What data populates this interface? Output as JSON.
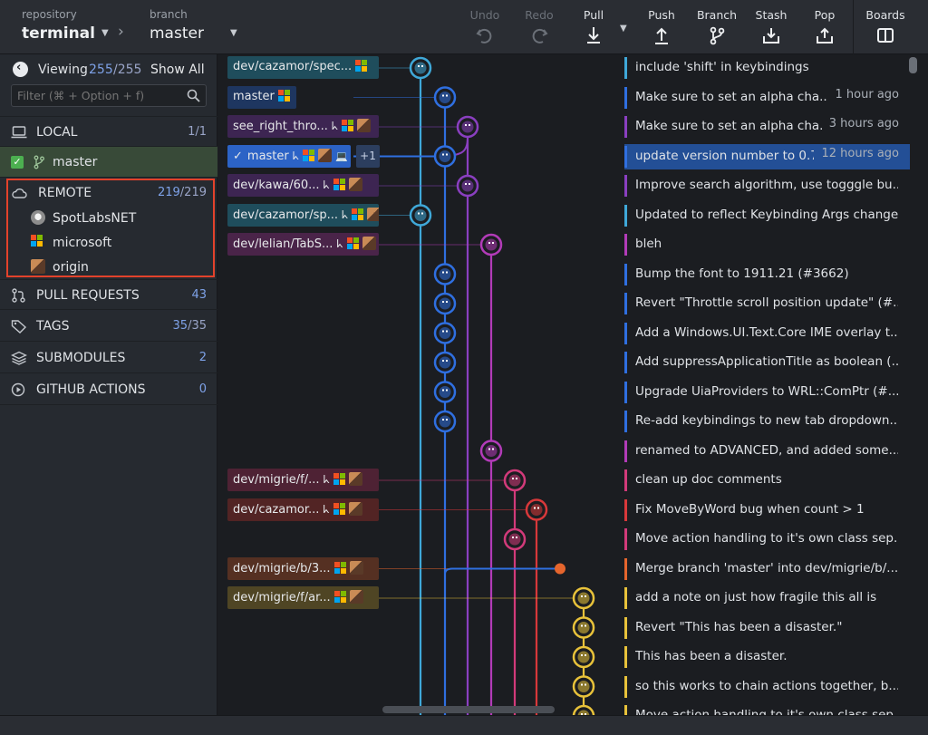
{
  "toolbar": {
    "repo_label": "repository",
    "repo_name": "terminal",
    "branch_label": "branch",
    "branch_name": "master",
    "buttons": {
      "undo": "Undo",
      "redo": "Redo",
      "pull": "Pull",
      "push": "Push",
      "branch": "Branch",
      "stash": "Stash",
      "pop": "Pop",
      "boards": "Boards"
    }
  },
  "sidebar": {
    "viewing_label": "Viewing",
    "viewing_count": "255",
    "viewing_total": "/255",
    "show_all": "Show All",
    "filter_placeholder": "Filter (⌘ + Option + f)",
    "local": {
      "label": "LOCAL",
      "count": "1/1"
    },
    "local_branch": "master",
    "remote": {
      "label": "REMOTE",
      "count": "219",
      "total": "/219"
    },
    "remotes": [
      "SpotLabsNET",
      "microsoft",
      "origin"
    ],
    "pull_requests": {
      "label": "PULL REQUESTS",
      "count": "43"
    },
    "tags": {
      "label": "TAGS",
      "count": "35",
      "total": "/35"
    },
    "submodules": {
      "label": "SUBMODULES",
      "count": "2"
    },
    "actions": {
      "label": "GITHUB ACTIONS",
      "count": "0"
    }
  },
  "graph": {
    "head_extra": "+1",
    "commits": [
      {
        "ref": "dev/cazamor/spec...",
        "message": "include 'shift' in keybindings",
        "time": "",
        "lane": 0,
        "color": "#3fa8d8"
      },
      {
        "ref": "master",
        "message": "Make sure to set an alpha cha...",
        "time": "1 hour ago",
        "lane": 1,
        "color": "#2f6fe0"
      },
      {
        "ref": "see_right_thro...",
        "message": "Make sure to set an alpha cha...",
        "time": "3 hours ago",
        "lane": 2,
        "color": "#8a3fc0"
      },
      {
        "ref": "master",
        "message": "update version number to 0.7",
        "time": "12 hours ago",
        "lane": 1,
        "color": "#2f6fe0",
        "selected": true
      },
      {
        "ref": "dev/kawa/60...",
        "message": "Improve search algorithm, use togggle bu...",
        "time": "",
        "lane": 2,
        "color": "#8a3fc0"
      },
      {
        "ref": "dev/cazamor/sp...",
        "message": "Updated to reflect Keybinding Args change",
        "time": "",
        "lane": 0,
        "color": "#3fa8d8"
      },
      {
        "ref": "dev/lelian/TabS...",
        "message": "bleh",
        "time": "",
        "lane": 3,
        "color": "#b23bb8"
      },
      {
        "ref": "",
        "message": "Bump the font to 1911.21 (#3662)",
        "time": "",
        "lane": 1,
        "color": "#2f6fe0"
      },
      {
        "ref": "",
        "message": "Revert \"Throttle scroll position update\" (#...",
        "time": "",
        "lane": 1,
        "color": "#2f6fe0"
      },
      {
        "ref": "",
        "message": "Add a Windows.UI.Text.Core IME overlay t...",
        "time": "",
        "lane": 1,
        "color": "#2f6fe0"
      },
      {
        "ref": "",
        "message": "Add suppressApplicationTitle as boolean (...",
        "time": "",
        "lane": 1,
        "color": "#2f6fe0"
      },
      {
        "ref": "",
        "message": "Upgrade UiaProviders to WRL::ComPtr (#...",
        "time": "",
        "lane": 1,
        "color": "#2f6fe0"
      },
      {
        "ref": "",
        "message": "Re-add keybindings to new tab dropdown...",
        "time": "",
        "lane": 1,
        "color": "#2f6fe0"
      },
      {
        "ref": "",
        "message": "renamed to ADVANCED, and added some...",
        "time": "",
        "lane": 3,
        "color": "#b23bb8"
      },
      {
        "ref": "dev/migrie/f/...",
        "message": "clean up doc comments",
        "time": "",
        "lane": 4,
        "color": "#d23a7a"
      },
      {
        "ref": "dev/cazamor...",
        "message": "Fix MoveByWord bug when count > 1",
        "time": "",
        "lane": 5,
        "color": "#d8383a"
      },
      {
        "ref": "",
        "message": "Move action handling to it's own class sep...",
        "time": "",
        "lane": 4,
        "color": "#d23a7a"
      },
      {
        "ref": "dev/migrie/b/3...",
        "message": "Merge branch 'master' into dev/migrie/b/...",
        "time": "",
        "lane": 5,
        "color": "#e5652d",
        "merge": true
      },
      {
        "ref": "dev/migrie/f/ar...",
        "message": "add a note on just how fragile this all is",
        "time": "",
        "lane": 6,
        "color": "#e8c23a"
      },
      {
        "ref": "",
        "message": "Revert \"This has been a disaster.\"",
        "time": "",
        "lane": 6,
        "color": "#e8c23a"
      },
      {
        "ref": "",
        "message": "This has been a disaster.",
        "time": "",
        "lane": 6,
        "color": "#e8c23a"
      },
      {
        "ref": "",
        "message": "so this works to chain actions together, b...",
        "time": "",
        "lane": 6,
        "color": "#e8c23a"
      },
      {
        "ref": "",
        "message": "Move action handling to it's own class sep...",
        "time": "",
        "lane": 6,
        "color": "#e8c23a"
      }
    ]
  }
}
